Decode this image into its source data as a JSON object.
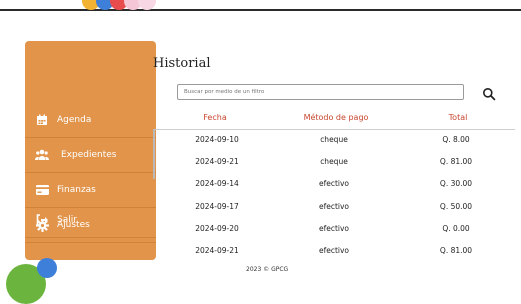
{
  "sidebar": {
    "items": [
      {
        "label": "Agenda",
        "icon": "calendar-icon"
      },
      {
        "label": "Expedientes",
        "icon": "users-icon"
      },
      {
        "label": "Finanzas",
        "icon": "credit-card-icon"
      },
      {
        "label": "Ajustes",
        "icon": "gear-icon"
      },
      {
        "label": "Salir",
        "icon": "logout-icon"
      }
    ]
  },
  "main": {
    "title": "Historial",
    "search_placeholder": "Buscar por medio de un filtro",
    "columns": [
      "Fecha",
      "Método de pago",
      "Total"
    ],
    "rows": [
      [
        "2024-09-10",
        "cheque",
        "Q. 8.00"
      ],
      [
        "2024-09-21",
        "cheque",
        "Q. 81.00"
      ],
      [
        "2024-09-14",
        "efectivo",
        "Q. 30.00"
      ],
      [
        "2024-09-17",
        "efectivo",
        "Q. 50.00"
      ],
      [
        "2024-09-20",
        "efectivo",
        "Q. 0.00"
      ],
      [
        "2024-09-21",
        "efectivo",
        "Q. 81.00"
      ]
    ]
  },
  "footer": "2023 © GPCG",
  "colors": {
    "sidebar": "#e1944a",
    "header_text": "#c7452e"
  }
}
